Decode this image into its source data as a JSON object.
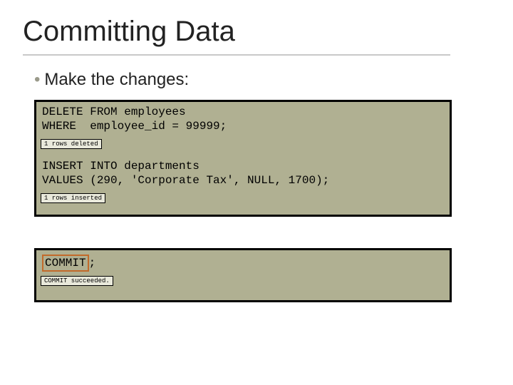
{
  "title": "Committing Data",
  "bullet": "Make the changes:",
  "panel1": {
    "sql1_line1": "DELETE FROM employees",
    "sql1_line2": "WHERE  employee_id = 99999;",
    "feedback1": "1 rows deleted",
    "sql2_line1": "INSERT INTO departments",
    "sql2_line2": "VALUES (290, 'Corporate Tax', NULL, 1700);",
    "feedback2": "1 rows inserted"
  },
  "panel2": {
    "commit_keyword": "COMMIT",
    "commit_terminator": ";",
    "feedback": "COMMIT succeeded."
  }
}
